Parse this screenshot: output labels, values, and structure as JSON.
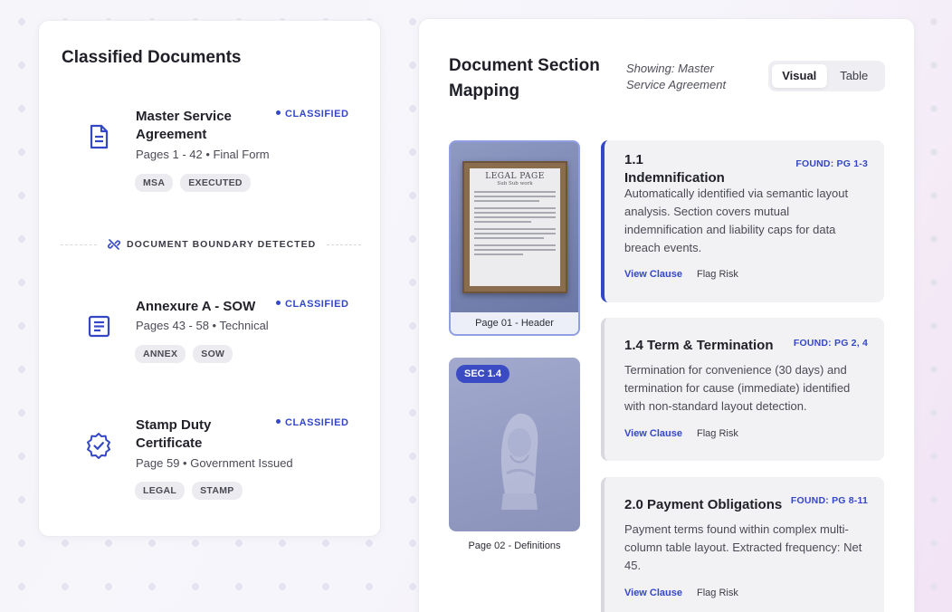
{
  "left": {
    "title": "Classified Documents",
    "documents": [
      {
        "name": "Master Service Agreement",
        "meta": "Pages 1 - 42 • Final Form",
        "status": "CLASSIFIED",
        "tags": [
          "MSA",
          "EXECUTED"
        ],
        "icon": "file-text-icon"
      },
      {
        "name": "Annexure A - SOW",
        "meta": "Pages 43 - 58 • Technical",
        "status": "CLASSIFIED",
        "tags": [
          "ANNEX",
          "SOW"
        ],
        "icon": "list-document-icon"
      },
      {
        "name": "Stamp Duty Certificate",
        "meta": "Page 59 • Government Issued",
        "status": "CLASSIFIED",
        "tags": [
          "LEGAL",
          "STAMP"
        ],
        "icon": "verified-badge-icon"
      }
    ],
    "boundary": {
      "text": "DOCUMENT BOUNDARY DETECTED",
      "icon": "broken-link-icon"
    }
  },
  "right": {
    "title": "Document Section Mapping",
    "showing": "Showing: Master Service Agreement",
    "toggle": {
      "options": [
        "Visual",
        "Table"
      ],
      "selected": "Visual"
    },
    "thumbnails": [
      {
        "caption": "Page 01 - Header",
        "paper_heading": "LEGAL PAGE",
        "paper_sub": "Sub Sub work"
      },
      {
        "caption": "Page 02 - Definitions",
        "badge": "SEC 1.4"
      }
    ],
    "sections": [
      {
        "title": "1.1 Indemnification",
        "found": "FOUND: PG 1-3",
        "body": "Automatically identified via semantic layout analysis. Section covers mutual indemnification and liability caps for data breach events.",
        "view": "View Clause",
        "flag": "Flag Risk",
        "active": true
      },
      {
        "title": "1.4 Term & Termination",
        "found": "FOUND: PG 2, 4",
        "body": "Termination for convenience (30 days) and termination for cause (immediate) identified with non-standard layout detection.",
        "view": "View Clause",
        "flag": "Flag Risk",
        "active": false
      },
      {
        "title": "2.0 Payment Obligations",
        "found": "FOUND: PG 8-11",
        "body": "Payment terms found within complex multi-column table layout. Extracted frequency: Net 45.",
        "view": "View Clause",
        "flag": "Flag Risk",
        "active": false
      }
    ]
  },
  "colors": {
    "accent": "#3448c7",
    "card": "#ffffff",
    "section_bg": "#f2f2f4",
    "tag_bg": "#ececf0"
  }
}
